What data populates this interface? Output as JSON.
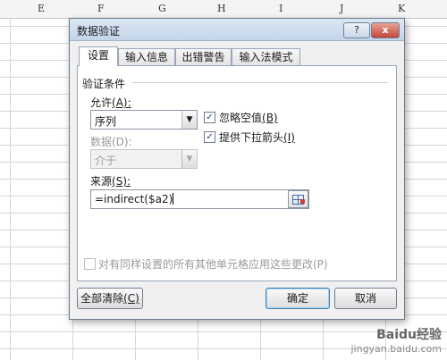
{
  "spreadsheet": {
    "column_headers": [
      "E",
      "F",
      "G",
      "H",
      "I",
      "J",
      "K"
    ]
  },
  "dialog": {
    "title": "数据验证",
    "help_label": "?",
    "close_label": "x",
    "tabs": [
      {
        "label": "设置",
        "active": true
      },
      {
        "label": "输入信息",
        "active": false
      },
      {
        "label": "出错警告",
        "active": false
      },
      {
        "label": "输入法模式",
        "active": false
      }
    ],
    "group_title": "验证条件",
    "allow": {
      "label": "允许",
      "accel": "(A):",
      "value": "序列"
    },
    "data": {
      "label": "数据(D):",
      "value": "介于"
    },
    "ignore_blank": {
      "label": "忽略空值",
      "accel": "(B)",
      "checked": true
    },
    "in_cell_dropdown": {
      "label": "提供下拉箭头",
      "accel": "(I)",
      "checked": true
    },
    "source": {
      "label": "来源",
      "accel": "(S):",
      "value": "=indirect($a2)"
    },
    "apply_all": {
      "label": "对有同样设置的所有其他单元格应用这些更改(P)",
      "checked": false
    },
    "buttons": {
      "clear_all": "全部清除",
      "clear_all_accel": "(C)",
      "ok": "确定",
      "cancel": "取消"
    }
  },
  "watermark": {
    "text": "Baidu经验",
    "sub": "jingyan.baidu.com"
  }
}
